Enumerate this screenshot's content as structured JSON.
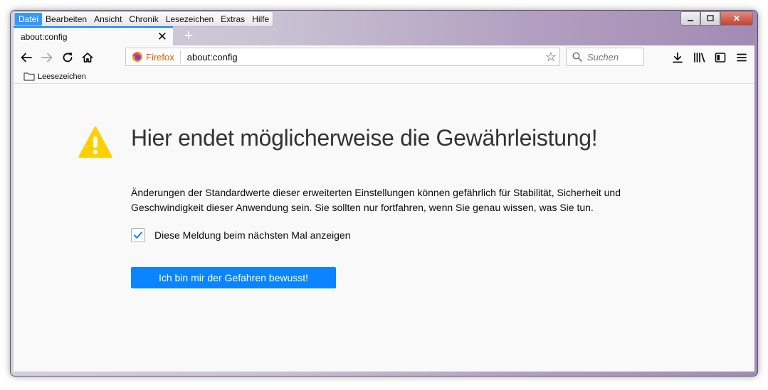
{
  "menu": [
    "Datei",
    "Bearbeiten",
    "Ansicht",
    "Chronik",
    "Lesezeichen",
    "Extras",
    "Hilfe"
  ],
  "tab": {
    "title": "about:config"
  },
  "urlbar": {
    "identity_label": "Firefox",
    "url": "about:config"
  },
  "search": {
    "placeholder": "Suchen"
  },
  "bookmarks": {
    "folder_label": "Leesezeichen"
  },
  "warning": {
    "title": "Hier endet möglicherweise die Gewährleistung!",
    "description_line1": "Änderungen der Standardwerte dieser erweiterten Einstellungen können gefährlich für Stabilität, Sicherheit und",
    "description_line2": "Geschwindigkeit dieser Anwendung sein. Sie sollten nur fortfahren, wenn Sie genau wissen, was Sie tun.",
    "checkbox_label": "Diese Meldung beim nächsten Mal anzeigen",
    "checkbox_checked": true,
    "accept_button": "Ich bin mir der Gefahren bewusst!"
  },
  "colors": {
    "accent": "#0a84ff",
    "warning": "#ffcf00",
    "firefox_label": "#e66000"
  },
  "icons": [
    "back-icon",
    "forward-icon",
    "reload-icon",
    "home-icon",
    "firefox-logo-icon",
    "bookmark-star-icon",
    "search-icon",
    "download-icon",
    "library-icon",
    "sidebar-icon",
    "menu-icon",
    "folder-icon",
    "warning-icon",
    "checkmark-icon"
  ]
}
